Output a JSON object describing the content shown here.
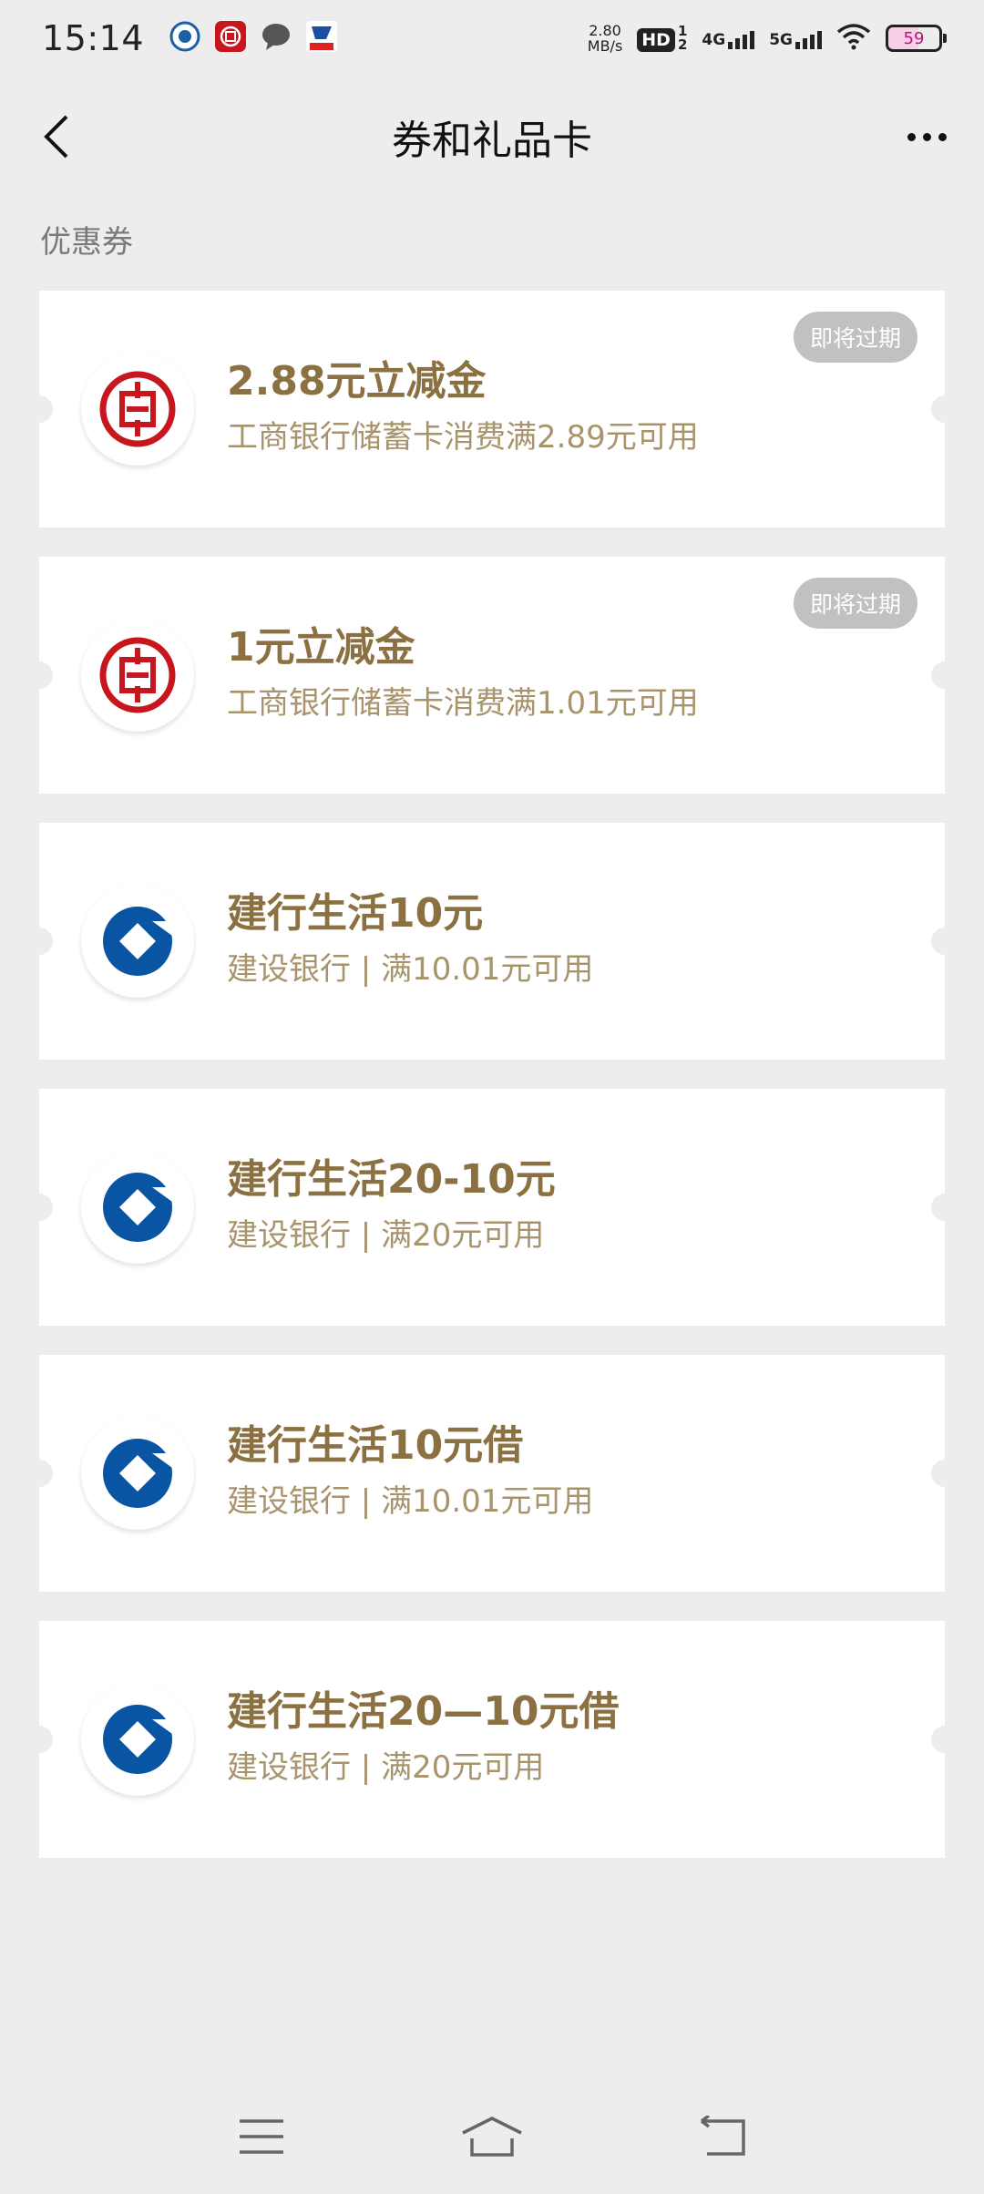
{
  "status_bar": {
    "time": "15:14",
    "speed_value": "2.80",
    "speed_unit": "MB/s",
    "hd": "HD",
    "hd_sub": "1",
    "hd_sub2": "2",
    "net1": "4G",
    "net2": "5G",
    "battery": "59",
    "app_icons": [
      "browser-icon",
      "icbc-app-icon",
      "chat-icon",
      "bank-app-icon"
    ]
  },
  "header": {
    "title": "券和礼品卡"
  },
  "section": {
    "label": "优惠券"
  },
  "colors": {
    "background": "#ededed",
    "card": "#ffffff",
    "coupon_title": "#8b7142",
    "coupon_desc": "#a8946c",
    "badge_bg": "#c1c1c1",
    "icbc_red": "#c7161e",
    "ccb_blue": "#0a55a3"
  },
  "coupons": [
    {
      "bank": "icbc",
      "title": "2.88元立减金",
      "desc": "工商银行储蓄卡消费满2.89元可用",
      "badge": "即将过期"
    },
    {
      "bank": "icbc",
      "title": "1元立减金",
      "desc": "工商银行储蓄卡消费满1.01元可用",
      "badge": "即将过期"
    },
    {
      "bank": "ccb",
      "title": "建行生活10元",
      "desc": "建设银行 | 满10.01元可用"
    },
    {
      "bank": "ccb",
      "title": "建行生活20-10元",
      "desc": "建设银行 | 满20元可用"
    },
    {
      "bank": "ccb",
      "title": "建行生活10元借",
      "desc": "建设银行 | 满10.01元可用"
    },
    {
      "bank": "ccb",
      "title": "建行生活20—10元借",
      "desc": "建设银行 | 满20元可用"
    }
  ],
  "nav": {
    "icons": [
      "menu-icon",
      "home-icon",
      "back-icon"
    ]
  }
}
